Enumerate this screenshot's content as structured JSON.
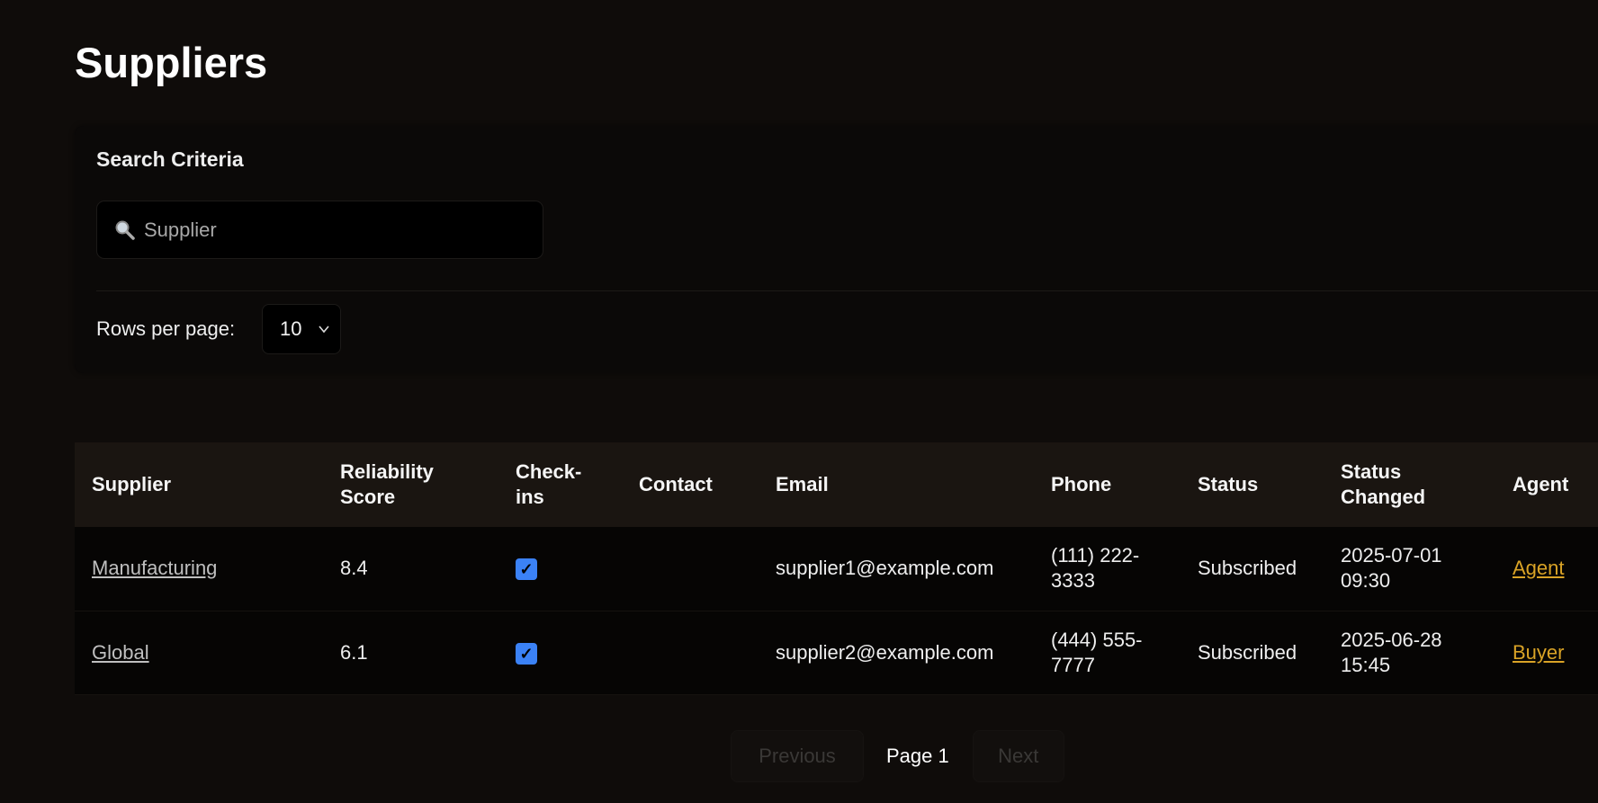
{
  "page": {
    "title": "Suppliers"
  },
  "search": {
    "heading": "Search Criteria",
    "placeholder": "Supplier",
    "value": "",
    "rows_label": "Rows per page:",
    "rows_value": "10"
  },
  "table": {
    "headers": [
      "Supplier",
      "Reliability Score",
      "Check-ins",
      "Contact",
      "Email",
      "Phone",
      "Status",
      "Status Changed",
      "Agent"
    ],
    "rows": [
      {
        "supplier": "Manufacturing",
        "score": "8.4",
        "checkins": true,
        "contact": "",
        "email": "supplier1@example.com",
        "phone": "(111) 222-3333",
        "status": "Subscribed",
        "changed": "2025-07-01 09:30",
        "agent": "Agent"
      },
      {
        "supplier": "Global",
        "score": "6.1",
        "checkins": true,
        "contact": "",
        "email": "supplier2@example.com",
        "phone": "(444) 555-7777",
        "status": "Subscribed",
        "changed": "2025-06-28 15:45",
        "agent": "Buyer"
      }
    ]
  },
  "pagination": {
    "previous": "Previous",
    "page": "Page 1",
    "next": "Next"
  },
  "colors": {
    "accent_link": "#d9a326",
    "checkbox": "#3b82f6"
  }
}
